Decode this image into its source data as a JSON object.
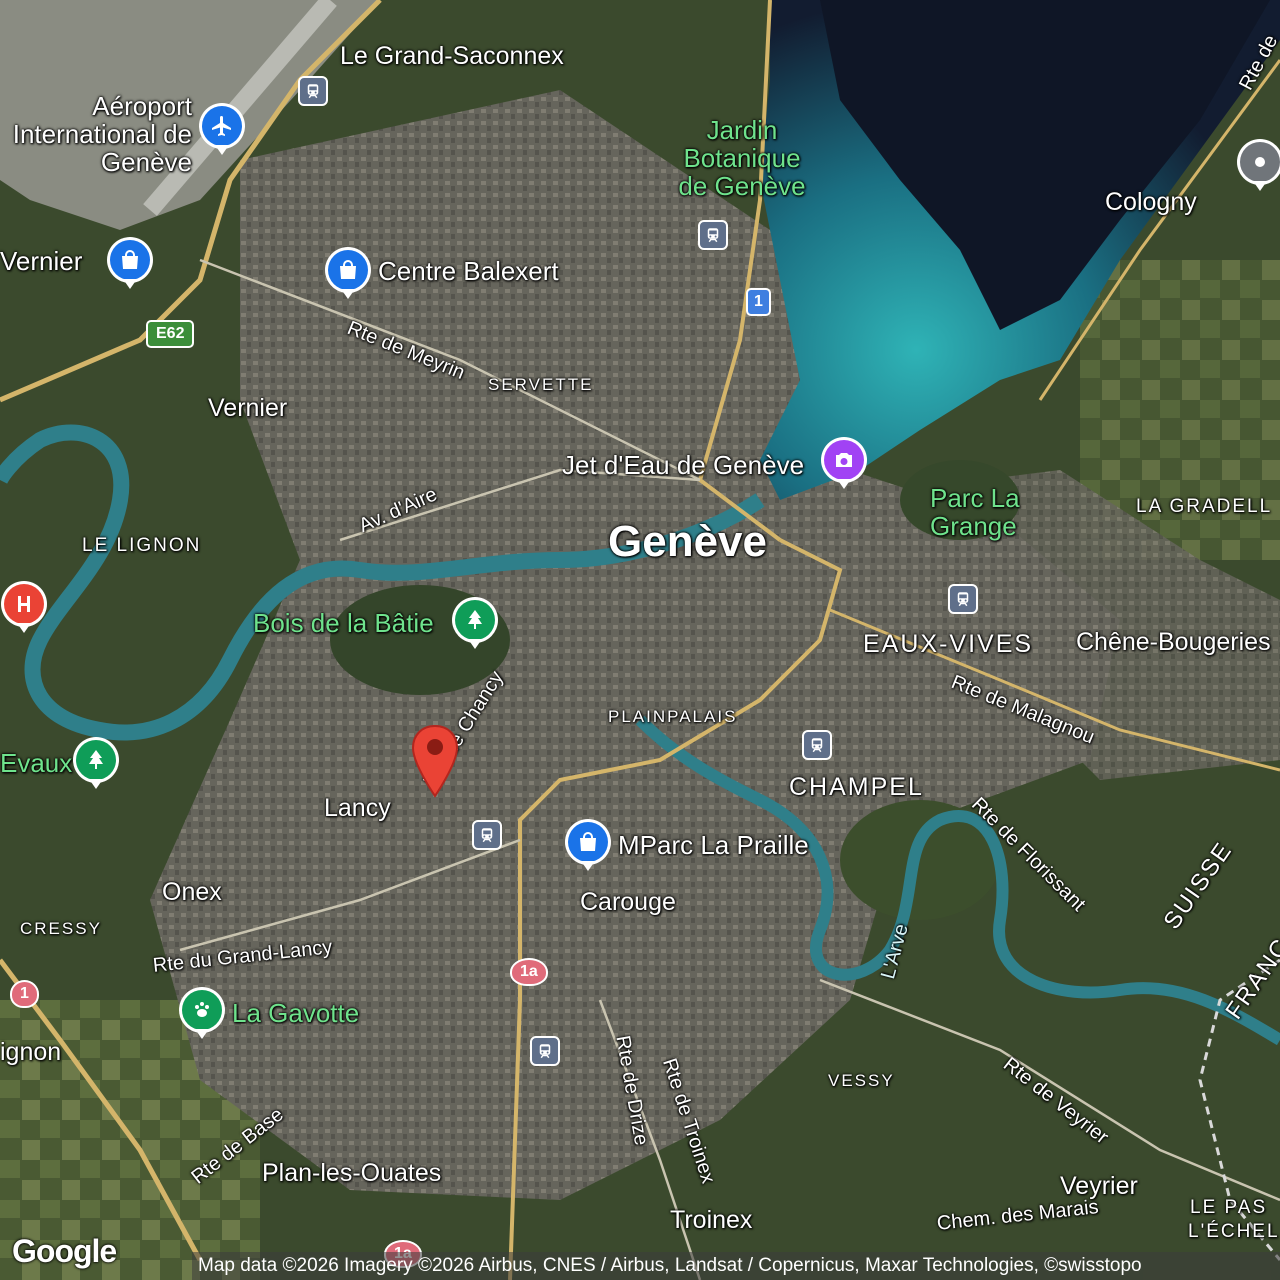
{
  "map": {
    "city": "Genève",
    "places": {
      "grand_saconnex": "Le Grand-Saconnex",
      "vernier_left": "Vernier",
      "vernier": "Vernier",
      "cologny": "Cologny",
      "lancy": "Lancy",
      "onex": "Onex",
      "carouge": "Carouge",
      "chene_bougeries": "Chêne-Bougeries",
      "plan_les_ouates": "Plan-les-Ouates",
      "veyrier": "Veyrier",
      "troinex": "Troinex",
      "ignon": "ignon"
    },
    "districts": {
      "servette": "SERVETTE",
      "le_lignon": "LE LIGNON",
      "plainpalais": "PLAINPALAIS",
      "cressy": "CRESSY",
      "vessy": "VESSY",
      "la_gradelle": "LA GRADELL",
      "eaux_vives": "EAUX-VIVES",
      "champel": "CHAMPEL",
      "le_pas_1": "LE PAS",
      "le_pas_2": "L'ÉCHEL",
      "suisse": "SUISSE",
      "france": "FRANC"
    },
    "pois": {
      "airport": "Aéroport International de Genève",
      "jardin": "Jardin Botanique de Genève",
      "balexert": "Centre Balexert",
      "jet_deau": "Jet d'Eau de Genève",
      "parc_la_grange": "Parc La Grange",
      "bois_batie": "Bois de la Bâtie",
      "evaux": "Evaux",
      "mparc": "MParc La Praille",
      "gavotte": "La Gavotte"
    },
    "roads": {
      "meyrin": "Rte de Meyrin",
      "aire": "Av. d'Aire",
      "chancy": "Rte de Chancy",
      "malagnou": "Rte de Malagnou",
      "florissant": "Rte de Florissant",
      "grand_lancy": "Rte du Grand-Lancy",
      "base": "Rte de Base",
      "drize": "Rte de Drize",
      "troinex": "Rte de Troinex",
      "veyrier": "Rte de Veyrier",
      "marais": "Chem. des Marais",
      "arve": "L'Arve",
      "rte_top_right": "Rte de"
    },
    "shields": {
      "e62": "E62",
      "one_a": "1",
      "one_b": "1",
      "one_a_lower": "1a",
      "one_a_bottom": "1a"
    },
    "colors": {
      "water_lake": "#10182a",
      "water_shallow": "#1f7f8c",
      "river": "#2f7f8a",
      "urban": "#6b6a62",
      "vegetation": "#3a4a2c",
      "road_major": "#d4b56a",
      "marker": "#ea4335"
    }
  },
  "attribution": "Map data ©2026 Imagery ©2026 Airbus, CNES / Airbus, Landsat / Copernicus, Maxar Technologies, ©swisstopo",
  "logo": "Google"
}
